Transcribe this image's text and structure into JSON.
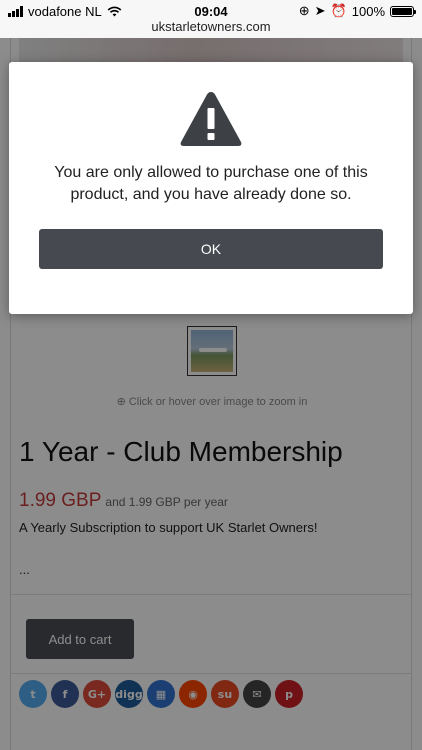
{
  "status_bar": {
    "carrier": "vodafone NL",
    "time": "09:04",
    "battery": "100%"
  },
  "browser": {
    "url": "ukstarletowners.com"
  },
  "product": {
    "zoom_hint": "Click or hover over image to zoom in",
    "title": "1 Year - Club Membership",
    "price": "1.99 GBP",
    "price_suffix": "and 1.99 GBP per year",
    "summary": "A Yearly Subscription to support UK Starlet Owners!",
    "ellipsis": "...",
    "add_to_cart_label": "Add to cart"
  },
  "share_buttons": [
    {
      "name": "twitter",
      "glyph": "t",
      "color": "#55acee"
    },
    {
      "name": "facebook",
      "glyph": "f",
      "color": "#3b5998"
    },
    {
      "name": "google-plus",
      "glyph": "G+",
      "color": "#dd4b39"
    },
    {
      "name": "digg",
      "glyph": "digg",
      "color": "#1d5c9c"
    },
    {
      "name": "delicious",
      "glyph": "▦",
      "color": "#3274d1"
    },
    {
      "name": "reddit",
      "glyph": "◉",
      "color": "#ff4500"
    },
    {
      "name": "stumbleupon",
      "glyph": "su",
      "color": "#eb4924"
    },
    {
      "name": "email",
      "glyph": "✉",
      "color": "#444444"
    },
    {
      "name": "pinterest",
      "glyph": "p",
      "color": "#cb2027"
    }
  ],
  "modal": {
    "icon": "warning-icon",
    "message": "You are only allowed to purchase one of this product, and you have already done so.",
    "ok_label": "OK"
  }
}
